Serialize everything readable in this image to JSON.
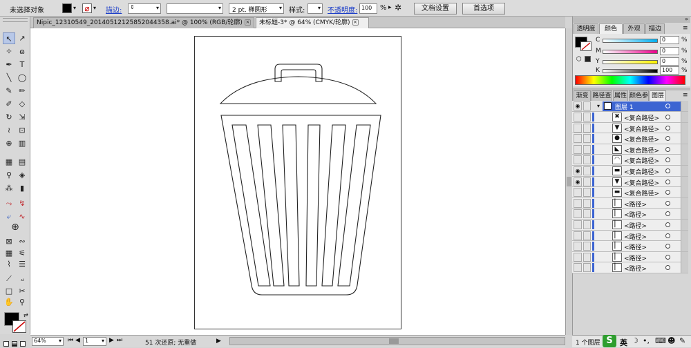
{
  "control_bar": {
    "selection_label": "未选择对象",
    "stroke_label": "描边:",
    "brush_value": "2 pt. 椭圆形",
    "style_label": "样式:",
    "opacity_label": "不透明度:",
    "opacity_value": "100",
    "opacity_unit": "%",
    "doc_setup_button": "文档设置",
    "preferences_button": "首选项"
  },
  "tabs": [
    {
      "label": "Nipic_12310549_20140512125852044358.ai* @ 100% (RGB/轮廓)"
    },
    {
      "label": "未标题-3* @ 64% (CMYK/轮廓)"
    }
  ],
  "status_bar": {
    "zoom_value": "64%",
    "page_value": "1",
    "history_text": "51 次还原; 无重做"
  },
  "color_panel": {
    "tabs": [
      "透明度",
      "颜色",
      "外观",
      "描边"
    ],
    "channels": [
      {
        "label": "C",
        "value": "0"
      },
      {
        "label": "M",
        "value": "0"
      },
      {
        "label": "Y",
        "value": "0"
      },
      {
        "label": "K",
        "value": "100"
      }
    ],
    "percent": "%"
  },
  "layers_panel": {
    "tabs": [
      "渐变",
      "路径查",
      "属性",
      "颜色参",
      "图层"
    ],
    "layer_name": "图层 1",
    "items": [
      {
        "label": "<复合路径>",
        "icon": "✖"
      },
      {
        "label": "<复合路径>",
        "icon": "▼"
      },
      {
        "label": "<复合路径>",
        "icon": "●"
      },
      {
        "label": "<复合路径>",
        "icon": "◣"
      },
      {
        "label": "<复合路径>",
        "icon": "◠"
      },
      {
        "label": "<复合路径>",
        "icon": "▬"
      },
      {
        "label": "<复合路径>",
        "icon": "▼"
      },
      {
        "label": "<复合路径>",
        "icon": "▬"
      },
      {
        "label": "<路径>",
        "icon": "▏"
      },
      {
        "label": "<路径>",
        "icon": "▏"
      },
      {
        "label": "<路径>",
        "icon": "▏"
      },
      {
        "label": "<路径>",
        "icon": "▏"
      },
      {
        "label": "<路径>",
        "icon": "▏"
      },
      {
        "label": "<路径>",
        "icon": "▏"
      },
      {
        "label": "<路径>",
        "icon": "▏"
      }
    ],
    "footer": "1 个图层"
  },
  "taskbar": {
    "ime_label": "英"
  },
  "colors": {
    "accent_blue": "#3c64d2",
    "selected_layer": "#3c64d2"
  }
}
